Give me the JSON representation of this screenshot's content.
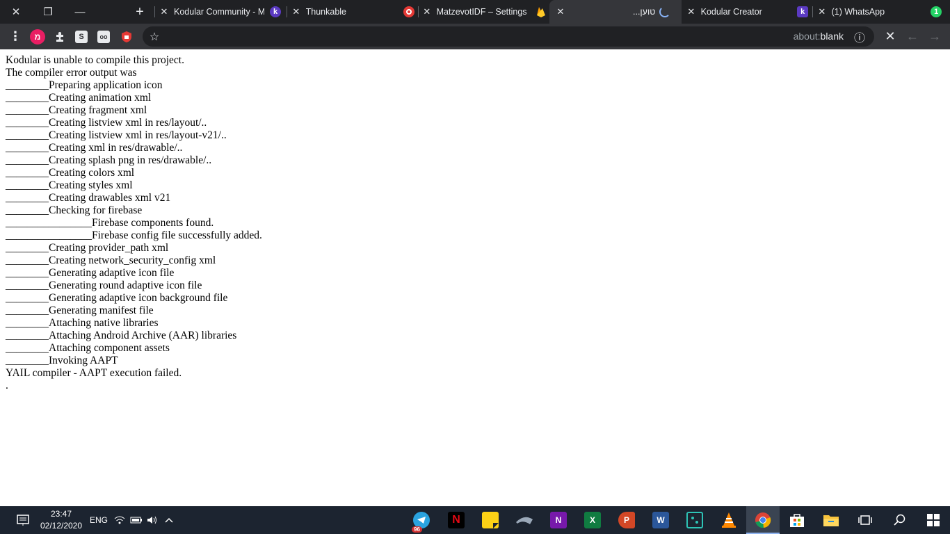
{
  "window_controls": {
    "close": "✕",
    "restore": "❐",
    "minimize": "—",
    "new_tab": "+"
  },
  "tabs": [
    {
      "title": "Kodular Community - M",
      "favicon": "k",
      "favicon_color": "#5b3ac2"
    },
    {
      "title": "Thunkable",
      "favicon": "thunkable-icon",
      "favicon_color": "#e53935"
    },
    {
      "title": "MatzevotIDF – Settings",
      "favicon": "firebase-icon",
      "favicon_color": "#ffca28"
    },
    {
      "title": "",
      "favicon": "",
      "active": true
    },
    {
      "title": "...טוען",
      "favicon": "loading-spinner"
    },
    {
      "title": "Kodular Creator",
      "favicon": "k",
      "favicon_color": "#5b3ac2"
    },
    {
      "title": "(1) WhatsApp",
      "favicon": "1",
      "favicon_color": "#25d366"
    }
  ],
  "toolbar": {
    "profile_letter": "מ",
    "extensions": [
      "puzzle-icon",
      "S",
      "oo",
      "shield-icon"
    ],
    "url_prefix": "about:",
    "url_main": "blank",
    "info_icon": "ⓘ",
    "stop_icon": "✕",
    "back_icon": "←",
    "forward_icon": "→"
  },
  "page": {
    "lines": [
      "Kodular is unable to compile this project.",
      "The compiler error output was",
      "________Preparing application icon",
      "________Creating animation xml",
      "________Creating fragment xml",
      "________Creating listview xml in res/layout/..",
      "________Creating listview xml in res/layout-v21/..",
      "________Creating xml in res/drawable/..",
      "________Creating splash png in res/drawable/..",
      "________Creating colors xml",
      "________Creating styles xml",
      "________Creating drawables xml v21",
      "________Checking for firebase",
      "________________Firebase components found.",
      "________________Firebase config file successfully added.",
      "________Creating provider_path xml",
      "________Creating network_security_config xml",
      "________Generating adaptive icon file",
      "________Generating round adaptive icon file",
      "________Generating adaptive icon background file",
      "________Generating manifest file",
      "________Attaching native libraries",
      "________Attaching Android Archive (AAR) libraries",
      "________Attaching component assets",
      "________Invoking AAPT",
      "YAIL compiler - AAPT execution failed.",
      "."
    ]
  },
  "taskbar": {
    "time": "23:47",
    "date": "02/12/2020",
    "language": "ENG",
    "telegram_badge": "96",
    "apps": [
      "telegram-icon",
      "netflix-icon",
      "sticky-notes-icon",
      "app-icon",
      "onenote-icon",
      "excel-icon",
      "powerpoint-icon",
      "word-icon",
      "photos-icon",
      "vlc-icon",
      "chrome-icon",
      "store-icon",
      "file-explorer-icon",
      "task-view-icon",
      "search-icon",
      "windows-start-icon"
    ]
  }
}
